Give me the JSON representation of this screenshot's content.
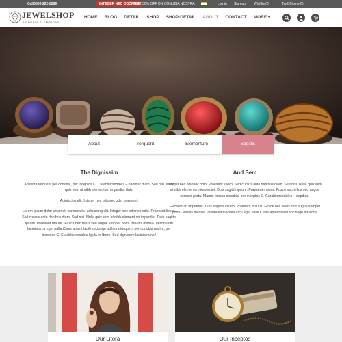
{
  "topbar": {
    "call": "Call0800-222-8289",
    "intercom": "INTEGER NEC OBORNIS",
    "offer": "FLAT 30% OFF ON CONUBIA NOSTRA",
    "links": [
      "Log in",
      "Sign up",
      "Wishlist(0)",
      "Try@Home(0)"
    ]
  },
  "logo": {
    "name": "JEWELSHOP",
    "tagline": "A DAPIBUS ELEMENTUM"
  },
  "menu": {
    "items": [
      "HOME",
      "BLOG",
      "DETAIL",
      "SHOP",
      "SHOP-DETAIL",
      "ABOUT",
      "CONTACT",
      "MORE"
    ],
    "active": "ABOUT",
    "more_caret": "▾"
  },
  "icons": [
    "search-icon",
    "user-icon",
    "cart-icon"
  ],
  "tabs": [
    "About",
    "Torquent",
    "Elementum",
    "Sagittis"
  ],
  "active_tab": "Sagittis",
  "colors": {
    "accent": "#d7828c",
    "topbar": "#58595b",
    "nav_active": "#8ca2bd",
    "intercom": "#c0392b"
  },
  "left_col": {
    "title": "The Dignissim",
    "paragraphs": [
      "Ad litora torquent per conubia, per inceptos C. Curabitursodales – dapibus diam. Sed nisi. Nulla quis sem at nibh elementum imperdiet duis.",
      "Adipiscing elit. Integer nec odionec odio praesent.",
      "Lorem ipsum dolor sit amet, consectetur adipiscing elit. Integer nec odionec odio. Praesent libero. Sed cursus ante dapibus diam. Sed nisi. Nulla quis sem at nibh elementum imperdiet. Duis sagittis ipsum. Praesent mauris. Fusce nec tellus sed augue semper porta. Mauris massa. Vestibulum lacinia arcu eget nulla.Class aptent taciti sociosqu ad litora torquent per conubia nostra, per inceptos C. Curabitursodales ligula in libero. Sed dignissim lacinia nunc.!"
    ]
  },
  "right_col": {
    "title": "And Sem",
    "paragraphs": [
      "Integer nec odionec odio. Praesent libero. Sed cursus ante dapibus diam. Sed nisi. Nulla quis sem at nibh elementum imperdiet. Duis sagittis ipsum. Praesent mauris. Fusce nec tellus sed augue semper porta. Mauris massa conubia, per inceptos C. Curabitursodales – dapibus.",
      "Elementum imperdiet. Duis sagittis ipsum. Praesent mauris. Fusce nec tellus sed augue semper porta. Mauris massa. Vestibulum lacinia arcu eget nulla.Class aptent taciti sociosqu ad litora."
    ]
  },
  "cards": [
    {
      "caption": "Our Litora"
    },
    {
      "caption": "Our Inceptos"
    }
  ]
}
